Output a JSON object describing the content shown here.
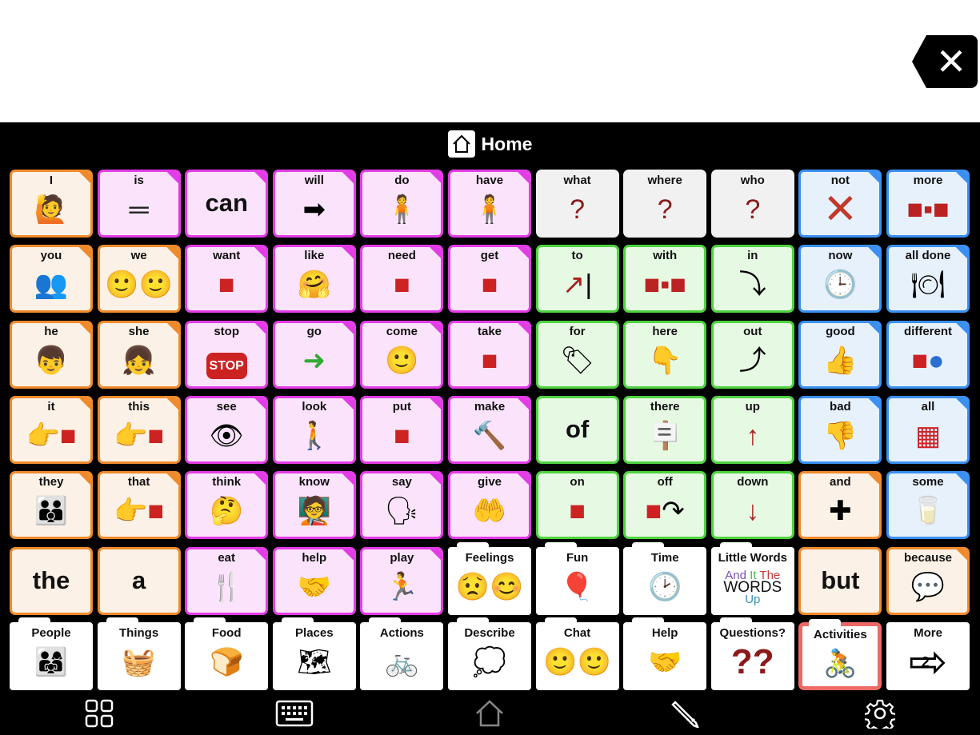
{
  "header": {
    "title": "Home",
    "home_icon": "house-icon"
  },
  "close_icon": "close-x-icon",
  "colors": {
    "pronoun": "#ef8a2c",
    "verb": "#e23ce6",
    "preposition": "#4fd340",
    "adjective": "#3a8ff0",
    "question": "#f1f1f1",
    "folder": "#ffffff",
    "activities_border": "#ec6a66"
  },
  "rows": [
    [
      {
        "label": "I",
        "type": "o",
        "icon": "point-self"
      },
      {
        "label": "is",
        "type": "v",
        "icon": "equals"
      },
      {
        "label": "can",
        "type": "v",
        "big": true
      },
      {
        "label": "will",
        "type": "v",
        "icon": "arrow-right"
      },
      {
        "label": "do",
        "type": "v",
        "icon": "person-doing"
      },
      {
        "label": "have",
        "type": "v",
        "icon": "person-holding"
      },
      {
        "label": "what",
        "type": "q",
        "icon": "question-person"
      },
      {
        "label": "where",
        "type": "q",
        "icon": "question-person"
      },
      {
        "label": "who",
        "type": "q",
        "icon": "question-face"
      },
      {
        "label": "not",
        "type": "a",
        "icon": "red-x"
      },
      {
        "label": "more",
        "type": "a",
        "icon": "red-blocks"
      }
    ],
    [
      {
        "label": "you",
        "type": "o",
        "icon": "two-people"
      },
      {
        "label": "we",
        "type": "o",
        "icon": "two-faces"
      },
      {
        "label": "want",
        "type": "v",
        "icon": "reach"
      },
      {
        "label": "like",
        "type": "v",
        "icon": "hug"
      },
      {
        "label": "need",
        "type": "v",
        "icon": "reach"
      },
      {
        "label": "get",
        "type": "v",
        "icon": "grab"
      },
      {
        "label": "to",
        "type": "p",
        "icon": "arrow-to-line"
      },
      {
        "label": "with",
        "type": "p",
        "icon": "red-blocks"
      },
      {
        "label": "in",
        "type": "p",
        "icon": "into-box"
      },
      {
        "label": "now",
        "type": "a",
        "icon": "clock-person"
      },
      {
        "label": "all done",
        "type": "a",
        "icon": "plate"
      }
    ],
    [
      {
        "label": "he",
        "type": "o",
        "icon": "boy"
      },
      {
        "label": "she",
        "type": "o",
        "icon": "girl"
      },
      {
        "label": "stop",
        "type": "v",
        "icon": "stop-sign"
      },
      {
        "label": "go",
        "type": "v",
        "icon": "green-arrow"
      },
      {
        "label": "come",
        "type": "v",
        "icon": "beckon"
      },
      {
        "label": "take",
        "type": "v",
        "icon": "take"
      },
      {
        "label": "for",
        "type": "p",
        "icon": "tag"
      },
      {
        "label": "here",
        "type": "p",
        "icon": "point-down"
      },
      {
        "label": "out",
        "type": "p",
        "icon": "out-of-box"
      },
      {
        "label": "good",
        "type": "a",
        "icon": "thumbs-up"
      },
      {
        "label": "different",
        "type": "a",
        "icon": "square-circle"
      }
    ],
    [
      {
        "label": "it",
        "type": "o",
        "icon": "point-block"
      },
      {
        "label": "this",
        "type": "o",
        "icon": "point-block"
      },
      {
        "label": "see",
        "type": "v",
        "icon": "eye-face"
      },
      {
        "label": "look",
        "type": "v",
        "icon": "look"
      },
      {
        "label": "put",
        "type": "v",
        "icon": "put"
      },
      {
        "label": "make",
        "type": "v",
        "icon": "hammer"
      },
      {
        "label": "of",
        "type": "p",
        "big": true
      },
      {
        "label": "there",
        "type": "p",
        "icon": "signpost"
      },
      {
        "label": "up",
        "type": "p",
        "icon": "arrow-up"
      },
      {
        "label": "bad",
        "type": "a",
        "icon": "thumbs-down"
      },
      {
        "label": "all",
        "type": "a",
        "icon": "bowl-blocks"
      }
    ],
    [
      {
        "label": "they",
        "type": "o",
        "icon": "group"
      },
      {
        "label": "that",
        "type": "o",
        "icon": "point-block"
      },
      {
        "label": "think",
        "type": "v",
        "icon": "think"
      },
      {
        "label": "know",
        "type": "v",
        "icon": "desk"
      },
      {
        "label": "say",
        "type": "v",
        "icon": "speak"
      },
      {
        "label": "give",
        "type": "v",
        "icon": "give"
      },
      {
        "label": "on",
        "type": "p",
        "icon": "on-surface"
      },
      {
        "label": "off",
        "type": "p",
        "icon": "off-surface"
      },
      {
        "label": "down",
        "type": "p",
        "icon": "arrow-down"
      },
      {
        "label": "and",
        "type": "o",
        "icon": "plus"
      },
      {
        "label": "some",
        "type": "a",
        "icon": "glass"
      }
    ],
    [
      {
        "label": "the",
        "type": "o",
        "big": true
      },
      {
        "label": "a",
        "type": "o",
        "big": true
      },
      {
        "label": "eat",
        "type": "v",
        "icon": "eat"
      },
      {
        "label": "help",
        "type": "v",
        "icon": "help"
      },
      {
        "label": "play",
        "type": "v",
        "icon": "play"
      },
      {
        "label": "Feelings",
        "type": "f",
        "icon": "faces"
      },
      {
        "label": "Fun",
        "type": "f",
        "icon": "balloon"
      },
      {
        "label": "Time",
        "type": "f",
        "icon": "clock"
      },
      {
        "label": "Little Words",
        "type": "f",
        "icon": "words",
        "words": [
          "And",
          "It",
          "The",
          "WORDS",
          "Up"
        ]
      },
      {
        "label": "but",
        "type": "o",
        "big": true
      },
      {
        "label": "because",
        "type": "o",
        "icon": "speech"
      }
    ],
    [
      {
        "label": "People",
        "type": "f",
        "icon": "people"
      },
      {
        "label": "Things",
        "type": "f",
        "icon": "things"
      },
      {
        "label": "Food",
        "type": "f",
        "icon": "food"
      },
      {
        "label": "Places",
        "type": "f",
        "icon": "map"
      },
      {
        "label": "Actions",
        "type": "f",
        "icon": "bike"
      },
      {
        "label": "Describe",
        "type": "f",
        "icon": "describe"
      },
      {
        "label": "Chat",
        "type": "f",
        "icon": "chat"
      },
      {
        "label": "Help",
        "type": "f",
        "icon": "help"
      },
      {
        "label": "Questions?",
        "type": "f",
        "icon": "questions"
      },
      {
        "label": "Activities",
        "type": "r",
        "icon": "activities"
      },
      {
        "label": "More",
        "type": "w",
        "icon": "next-page",
        "page": "2"
      }
    ]
  ],
  "toolbar": [
    {
      "name": "grid-icon"
    },
    {
      "name": "keyboard-icon"
    },
    {
      "name": "home-icon"
    },
    {
      "name": "pencil-icon"
    },
    {
      "name": "gear-icon"
    }
  ]
}
